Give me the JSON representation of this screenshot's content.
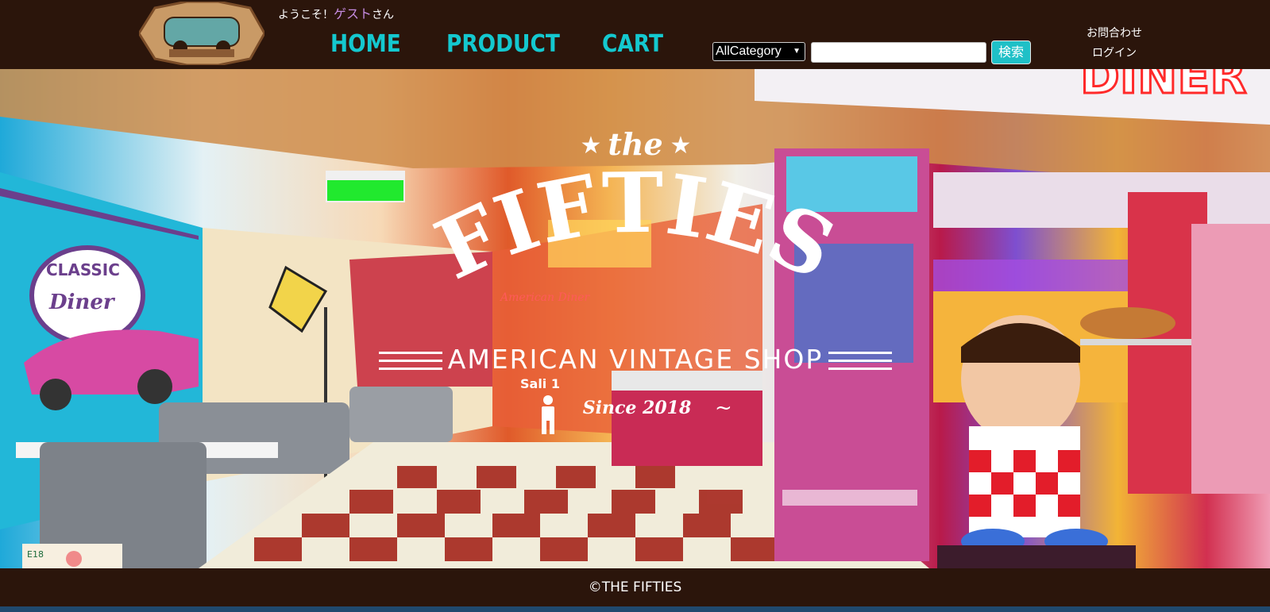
{
  "welcome": {
    "prefix": "ようこそ！",
    "guest": "ゲスト",
    "suffix": "さん"
  },
  "nav": {
    "home": "HOME",
    "product": "PRODUCT",
    "cart": "CART"
  },
  "search": {
    "category": "AllCategory",
    "query": "",
    "button": "検索"
  },
  "links": {
    "contact": "お問合わせ",
    "login": "ログイン"
  },
  "hero": {
    "brand_small": "the",
    "brand_main": "FIFTIES",
    "tagline": "AMERICAN VINTAGE SHOP",
    "since": "Since 2018",
    "sign_classic": "CLASSIC",
    "sign_diner": "Diner",
    "sign_top": "DINER",
    "neon": "American Diner",
    "sali": "Sali 1",
    "e18": "E18"
  },
  "footer": {
    "copyright": "©THE FIFTIES"
  },
  "colors": {
    "header_bg": "#2b150b",
    "nav_text": "#14c8cf",
    "search_btn": "#1fc0c7"
  }
}
